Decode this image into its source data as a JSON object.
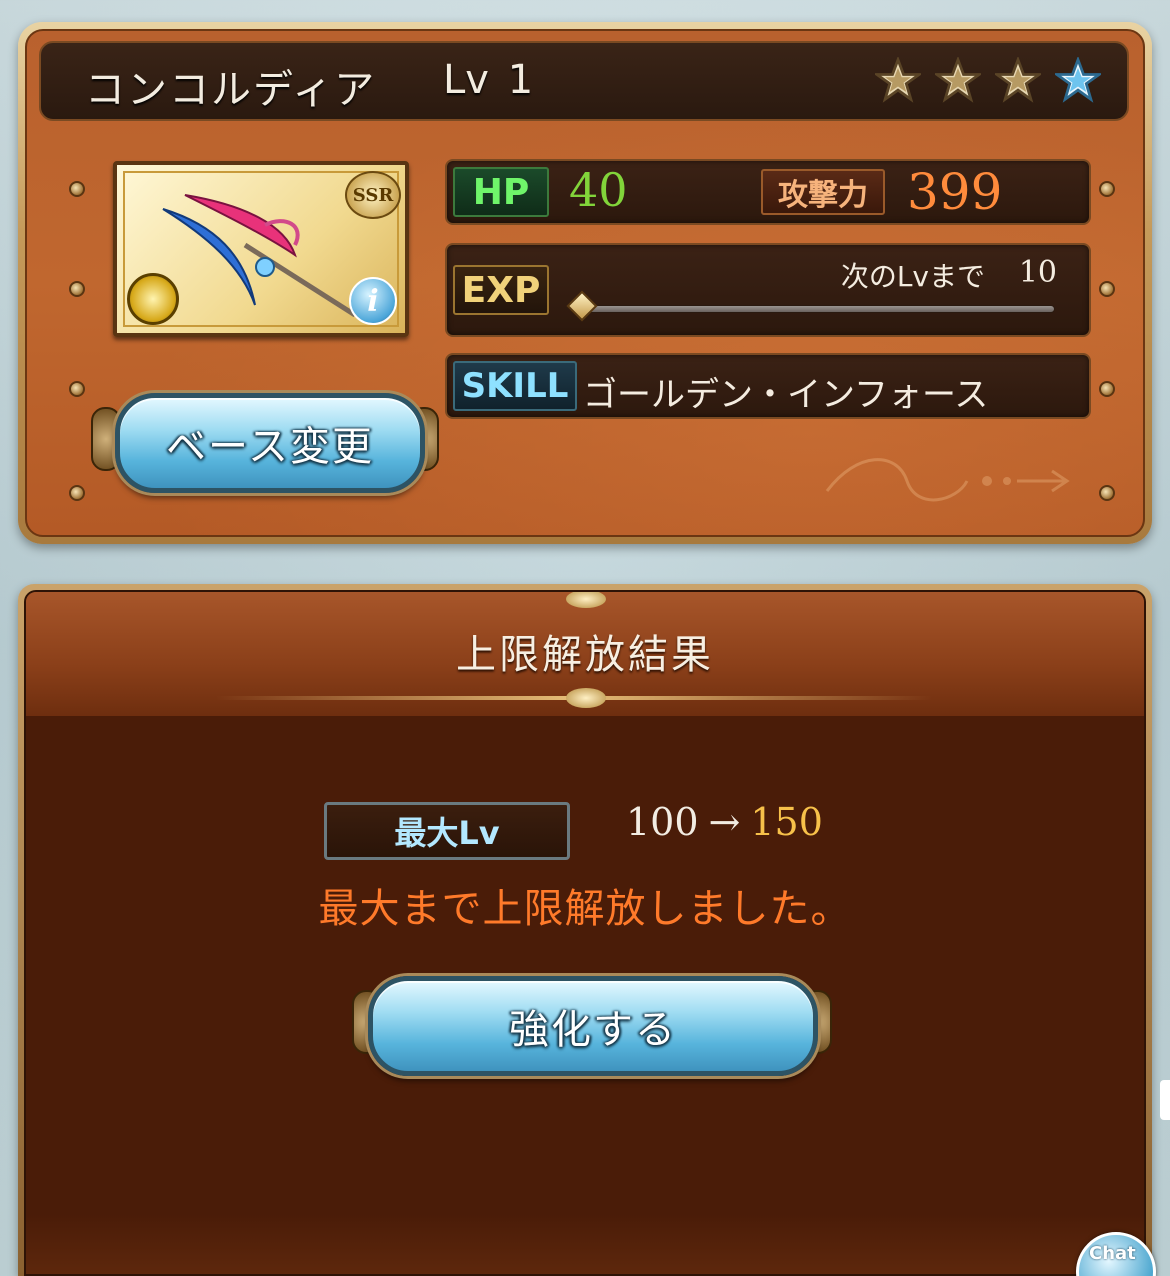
{
  "weapon": {
    "name": "コンコルディア",
    "level_label": "Lv",
    "level_value": "1",
    "rarity": "SSR",
    "stars_filled": 3,
    "stars_total": 4,
    "hp_label": "HP",
    "hp_value": "40",
    "atk_label": "攻撃力",
    "atk_value": "399",
    "exp_label": "EXP",
    "next_label": "次のLvまで",
    "next_value": "10",
    "exp_progress": 0,
    "skill_label": "SKILL",
    "skill_name": "ゴールデン・インフォース",
    "info_icon": "i",
    "element_icon": "light-element-icon"
  },
  "buttons": {
    "base_change": "ベース変更",
    "enhance": "強化する",
    "corner": "Chat"
  },
  "result": {
    "title": "上限解放結果",
    "max_lv_label": "最大Lv",
    "max_lv_old": "100",
    "arrow": "→",
    "max_lv_new": "150",
    "message": "最大まで上限解放しました。"
  }
}
